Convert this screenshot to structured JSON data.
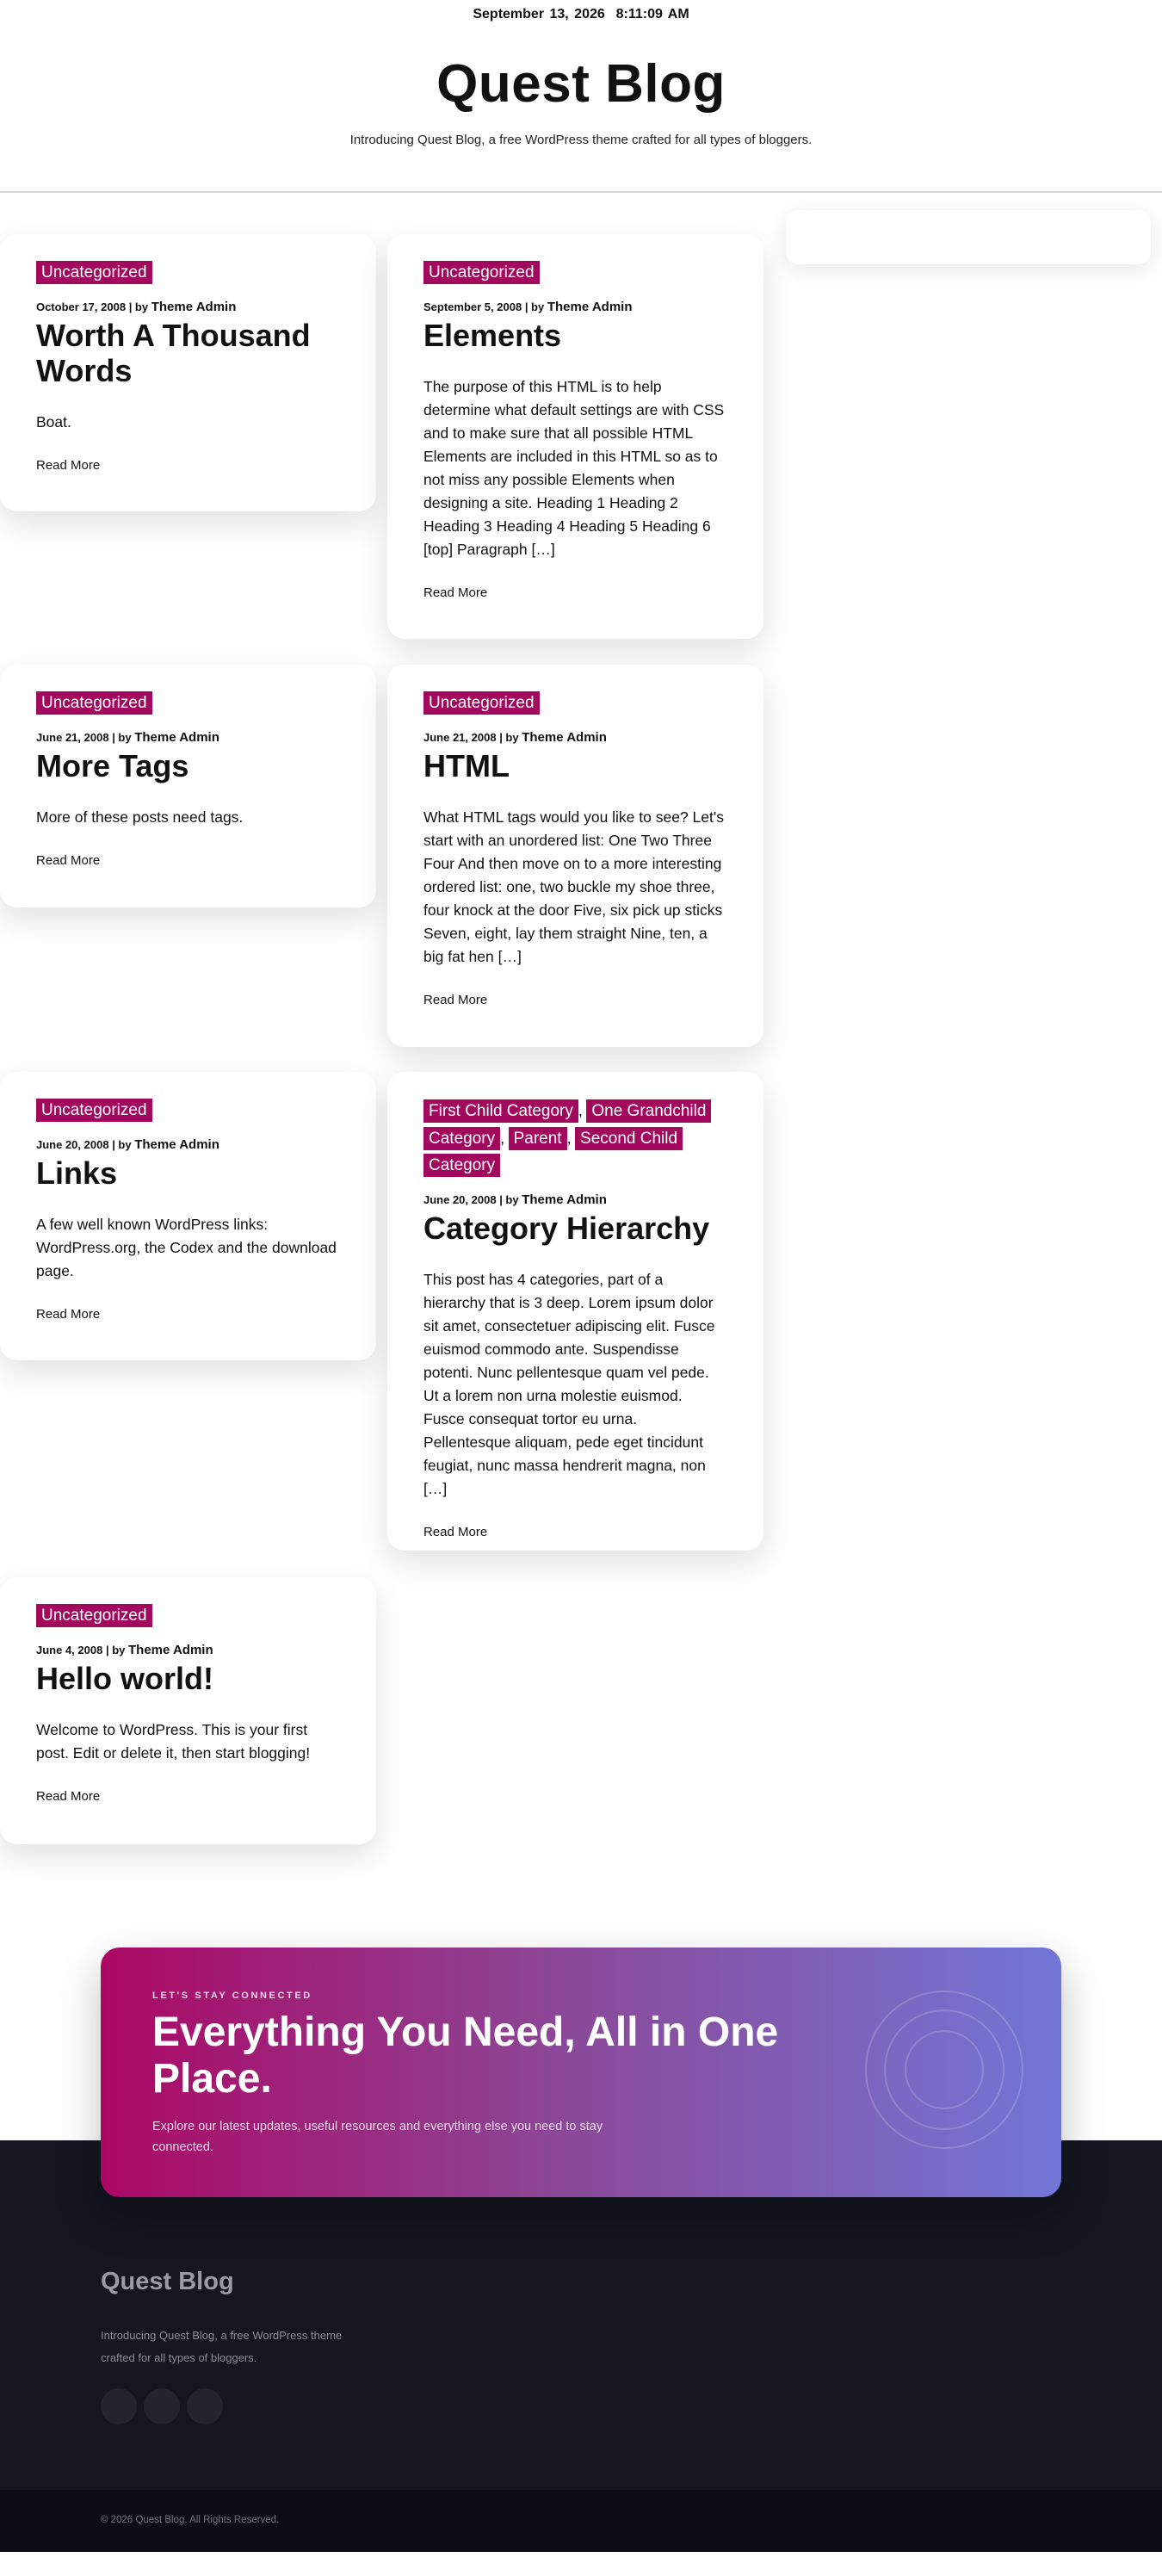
{
  "header": {
    "date": "September 13, 2026",
    "time": "8:11:09 AM",
    "site_title": "Quest Blog",
    "tagline": "Introducing Quest Blog, a free WordPress theme crafted for all types of bloggers."
  },
  "posts": [
    {
      "categories": [
        "Uncategorized"
      ],
      "date": "October 17, 2008",
      "by": "| by",
      "author": "Theme Admin",
      "title": "Worth A Thousand Words",
      "excerpt": "Boat.",
      "read_more": "Read More"
    },
    {
      "categories": [
        "Uncategorized"
      ],
      "date": "September 5, 2008",
      "by": "| by",
      "author": "Theme Admin",
      "title": "Elements",
      "excerpt": "The purpose of this HTML is to help determine what default settings are with CSS and to make sure that all possible HTML Elements are included in this HTML so as to not miss any possible Elements when designing a site. Heading 1 Heading 2 Heading 3 Heading 4 Heading 5 Heading 6 [top] Paragraph […]",
      "read_more": "Read More"
    },
    {
      "categories": [
        "Uncategorized"
      ],
      "date": "June 21, 2008",
      "by": "| by",
      "author": "Theme Admin",
      "title": "More Tags",
      "excerpt": "More of these posts need tags.",
      "read_more": "Read More"
    },
    {
      "categories": [
        "Uncategorized"
      ],
      "date": "June 21, 2008",
      "by": "| by",
      "author": "Theme Admin",
      "title": "HTML",
      "excerpt": "What HTML tags would you like to see? Let's start with an unordered list: One Two Three Four And then move on to a more interesting ordered list: one, two buckle my shoe three, four knock at the door Five, six pick up sticks Seven, eight, lay them straight Nine, ten, a big fat hen […]",
      "read_more": "Read More"
    },
    {
      "categories": [
        "Uncategorized"
      ],
      "date": "June 20, 2008",
      "by": "| by",
      "author": "Theme Admin",
      "title": "Links",
      "excerpt": "A few well known WordPress links: WordPress.org, the Codex and the download page.",
      "read_more": "Read More"
    },
    {
      "categories": [
        "First Child Category",
        "One Grandchild Category",
        "Parent",
        "Second Child Category"
      ],
      "category_separator": ",",
      "date": "June 20, 2008",
      "by": "| by",
      "author": "Theme Admin",
      "title": "Category Hierarchy",
      "excerpt": "This post has 4 categories, part of a hierarchy that is 3 deep. Lorem ipsum dolor sit amet, consectetuer adipiscing elit. Fusce euismod commodo ante. Suspendisse potenti. Nunc pellentesque quam vel pede. Ut a lorem non urna molestie euismod. Fusce consequat tortor eu urna. Pellentesque aliquam, pede eget tincidunt feugiat, nunc massa hendrerit magna, non […]",
      "read_more": "Read More"
    },
    {
      "categories": [
        "Uncategorized"
      ],
      "date": "June 4, 2008",
      "by": "| by",
      "author": "Theme Admin",
      "title": "Hello world!",
      "excerpt": "Welcome to WordPress. This is your first post. Edit or delete it, then start blogging!",
      "read_more": "Read More"
    }
  ],
  "newsletter": {
    "eyebrow": "LET'S STAY CONNECTED",
    "title": "Everything You Need, All in One Place.",
    "description": "Explore our latest updates, useful resources and everything else you need to stay connected."
  },
  "footer": {
    "title": "Quest Blog",
    "description": "Introducing Quest Blog, a free WordPress theme crafted for all types of bloggers.",
    "social_icons": [
      "social-icon",
      "social-icon",
      "social-icon"
    ],
    "copyright": "© 2026 Quest Blog. All Rights Reserved."
  },
  "colors": {
    "category_badge": "#a3085f",
    "footer_bg": "#141620",
    "gradient_start": "#ab0864",
    "gradient_end": "#7276d6"
  }
}
